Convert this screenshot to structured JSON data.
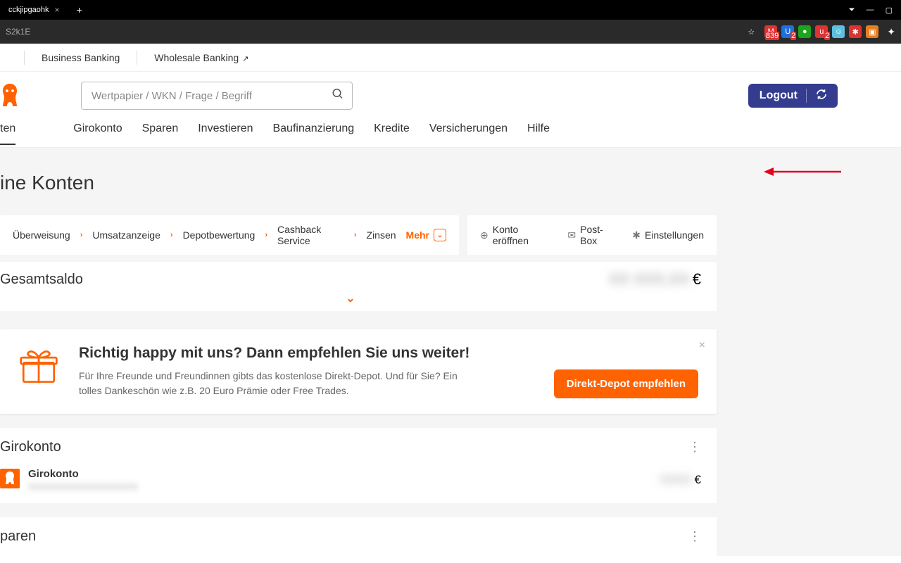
{
  "browser": {
    "tab_title": "cckjipgaohk",
    "url_text": "S2k1E",
    "ext_badge1": "839",
    "ext_badge2": "2",
    "ext_badge3": "2"
  },
  "top_links": {
    "business": "Business Banking",
    "wholesale": "Wholesale Banking"
  },
  "search": {
    "placeholder": "Wertpapier / WKN / Frage / Begriff"
  },
  "header": {
    "logout": "Logout"
  },
  "main_nav": {
    "konten": "ten",
    "girokonto": "Girokonto",
    "sparen": "Sparen",
    "investieren": "Investieren",
    "baufinanzierung": "Baufinanzierung",
    "kredite": "Kredite",
    "versicherungen": "Versicherungen",
    "hilfe": "Hilfe"
  },
  "page": {
    "title": "ine Konten"
  },
  "actions_left": {
    "uberweisung": "Überweisung",
    "umsatz": "Umsatzanzeige",
    "depot": "Depotbewertung",
    "cashback": "Cashback Service",
    "zinsen": "Zinsen",
    "mehr": "Mehr"
  },
  "actions_right": {
    "konto": "Konto eröffnen",
    "postbox": "Post-Box",
    "einstellungen": "Einstellungen"
  },
  "balance": {
    "label": "Gesamtsaldo",
    "hidden": "XX XXX,XX",
    "currency": "€"
  },
  "promo": {
    "title": "Richtig happy mit uns? Dann empfehlen Sie uns weiter!",
    "body": "Für Ihre Freunde und Freundinnen gibts das kostenlose Direkt-Depot. Und für Sie? Ein tolles Dankeschön wie z.B. 20 Euro Prämie oder Free Trades.",
    "button": "Direkt-Depot empfehlen"
  },
  "accounts": {
    "giro_title": "Girokonto",
    "giro_name": "Girokonto",
    "giro_sub": "XXXXXXXXXXXXXXXXXX",
    "giro_hidden": "XXXX",
    "currency": "€",
    "sparen_title": "paren"
  }
}
